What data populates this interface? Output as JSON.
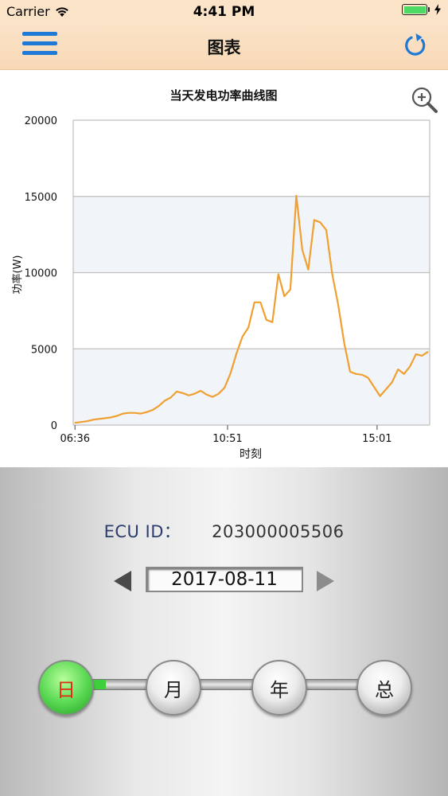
{
  "status_bar": {
    "carrier": "Carrier",
    "time": "4:41 PM"
  },
  "nav": {
    "title": "图表",
    "menu_icon": "hamburger-menu-icon",
    "refresh_icon": "refresh-icon"
  },
  "chart_data": {
    "type": "line",
    "title": "当天发电功率曲线图",
    "xlabel": "时刻",
    "ylabel": "功率(W)",
    "x_tick_labels": [
      "06:36",
      "10:51",
      "15:01"
    ],
    "y_ticks": [
      0,
      5000,
      10000,
      15000,
      20000
    ],
    "ylim": [
      0,
      20000
    ],
    "grid": "horizontal",
    "color": "#f0a030",
    "x": [
      "06:36",
      "06:46",
      "06:56",
      "07:06",
      "07:16",
      "07:26",
      "07:36",
      "07:46",
      "07:56",
      "08:06",
      "08:16",
      "08:26",
      "08:36",
      "08:46",
      "08:56",
      "09:06",
      "09:16",
      "09:26",
      "09:36",
      "09:46",
      "09:56",
      "10:06",
      "10:16",
      "10:26",
      "10:36",
      "10:46",
      "10:56",
      "11:06",
      "11:16",
      "11:26",
      "11:36",
      "11:46",
      "11:56",
      "12:06",
      "12:16",
      "12:26",
      "12:36",
      "12:46",
      "12:56",
      "13:06",
      "13:16",
      "13:26",
      "13:36",
      "13:46",
      "13:56",
      "14:06",
      "14:16",
      "14:26",
      "14:36",
      "14:46",
      "14:56",
      "15:06",
      "15:16",
      "15:26",
      "15:36",
      "15:46",
      "15:56",
      "16:06",
      "16:16",
      "16:26"
    ],
    "values": [
      150,
      200,
      250,
      350,
      400,
      450,
      500,
      600,
      750,
      800,
      800,
      750,
      850,
      1000,
      1250,
      1600,
      1800,
      2200,
      2100,
      1950,
      2050,
      2250,
      2000,
      1850,
      2050,
      2450,
      3400,
      4700,
      5800,
      6400,
      8050,
      8050,
      6900,
      6750,
      9900,
      8450,
      8900,
      15050,
      11500,
      10200,
      13450,
      13300,
      12800,
      9900,
      7900,
      5400,
      3500,
      3350,
      3300,
      3100,
      2500,
      1900,
      2350,
      2800,
      3650,
      3350,
      3850,
      4650,
      4550,
      4800
    ]
  },
  "zoom_icon": "zoom-in-icon",
  "ecu": {
    "label": "ECU ID：",
    "value": "203000005506"
  },
  "date": {
    "value": "2017-08-11",
    "prev_icon": "triangle-left-icon",
    "next_icon": "triangle-right-icon"
  },
  "periods": [
    {
      "label": "日",
      "active": true
    },
    {
      "label": "月",
      "active": false
    },
    {
      "label": "年",
      "active": false
    },
    {
      "label": "总",
      "active": false
    }
  ]
}
